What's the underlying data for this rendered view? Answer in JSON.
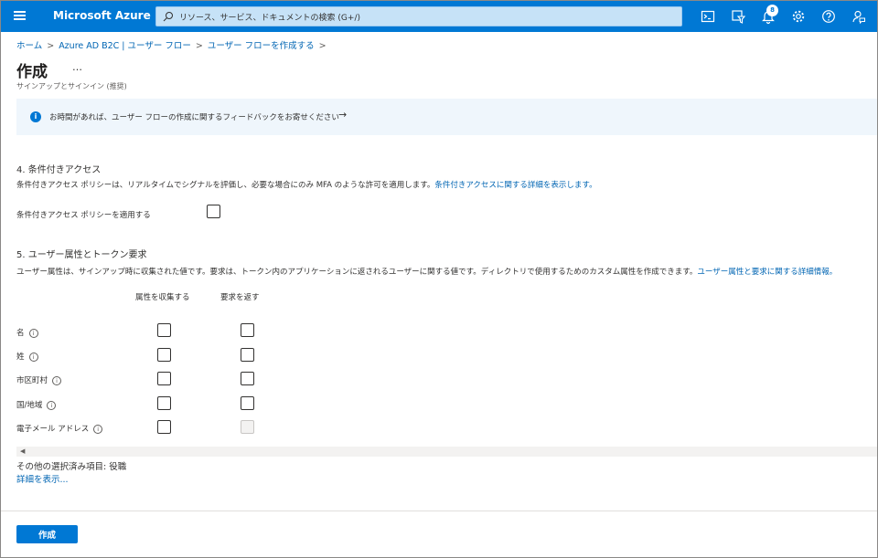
{
  "topbar": {
    "brand": "Microsoft Azure",
    "search_placeholder": "リソース、サービス、ドキュメントの検索 (G+/)",
    "notification_count": "8",
    "icons": [
      "cloud-shell-icon",
      "directory-filter-icon",
      "bell-icon",
      "gear-icon",
      "help-icon",
      "feedback-icon"
    ]
  },
  "breadcrumb": [
    "ホーム",
    "Azure AD B2C | ユーザー フロー",
    "ユーザー フローを作成する"
  ],
  "header": {
    "title": "作成",
    "more": "…",
    "subtitle": "サインアップとサインイン (推奨)"
  },
  "banner": {
    "text": "お時間があれば、ユーザー フローの作成に関するフィードバックをお寄せください",
    "arrow": "→"
  },
  "section4": {
    "title": "4. 条件付きアクセス",
    "description": "条件付きアクセス ポリシーは、リアルタイムでシグナルを評価し、必要な場合にのみ MFA のような許可を適用します。",
    "link": "条件付きアクセスに関する詳細を表示します。",
    "checkbox_label": "条件付きアクセス ポリシーを適用する"
  },
  "section5": {
    "title": "5. ユーザー属性とトークン要求",
    "description": "ユーザー属性は、サインアップ時に収集された値です。要求は、トークン内のアプリケーションに返されるユーザーに関する値です。ディレクトリで使用するためのカスタム属性を作成できます。",
    "link": "ユーザー属性と要求に関する詳細情報。",
    "columns": [
      "属性を収集する",
      "要求を返す"
    ],
    "rows": [
      {
        "label": "名",
        "collect": false,
        "return": false,
        "return_disabled": false
      },
      {
        "label": "姓",
        "collect": false,
        "return": false,
        "return_disabled": false
      },
      {
        "label": "市区町村",
        "collect": false,
        "return": false,
        "return_disabled": false
      },
      {
        "label": "国/地域",
        "collect": false,
        "return": false,
        "return_disabled": false
      },
      {
        "label": "電子メール アドレス",
        "collect": false,
        "return": false,
        "return_disabled": true
      }
    ],
    "other_selected": "その他の選択済み項目: 役職",
    "show_more": "詳細を表示..."
  },
  "footer": {
    "create_label": "作成"
  }
}
